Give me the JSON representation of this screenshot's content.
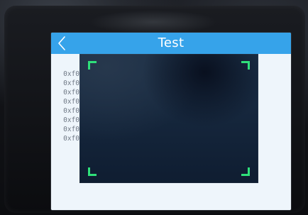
{
  "screen": {
    "title": "Test",
    "back_icon": "chevron-left-icon",
    "lines": [
      "0xf0",
      "0xf0",
      "0xf0",
      "0xf0",
      "0xf0",
      "0xf0",
      "0xf0",
      "0xf0"
    ]
  },
  "colors": {
    "titlebar": "#36a3ea",
    "title_text": "#ffffff",
    "frame_corners": "#2fe07a",
    "screen_bg": "#eef5fb",
    "text": "#6f7885"
  }
}
